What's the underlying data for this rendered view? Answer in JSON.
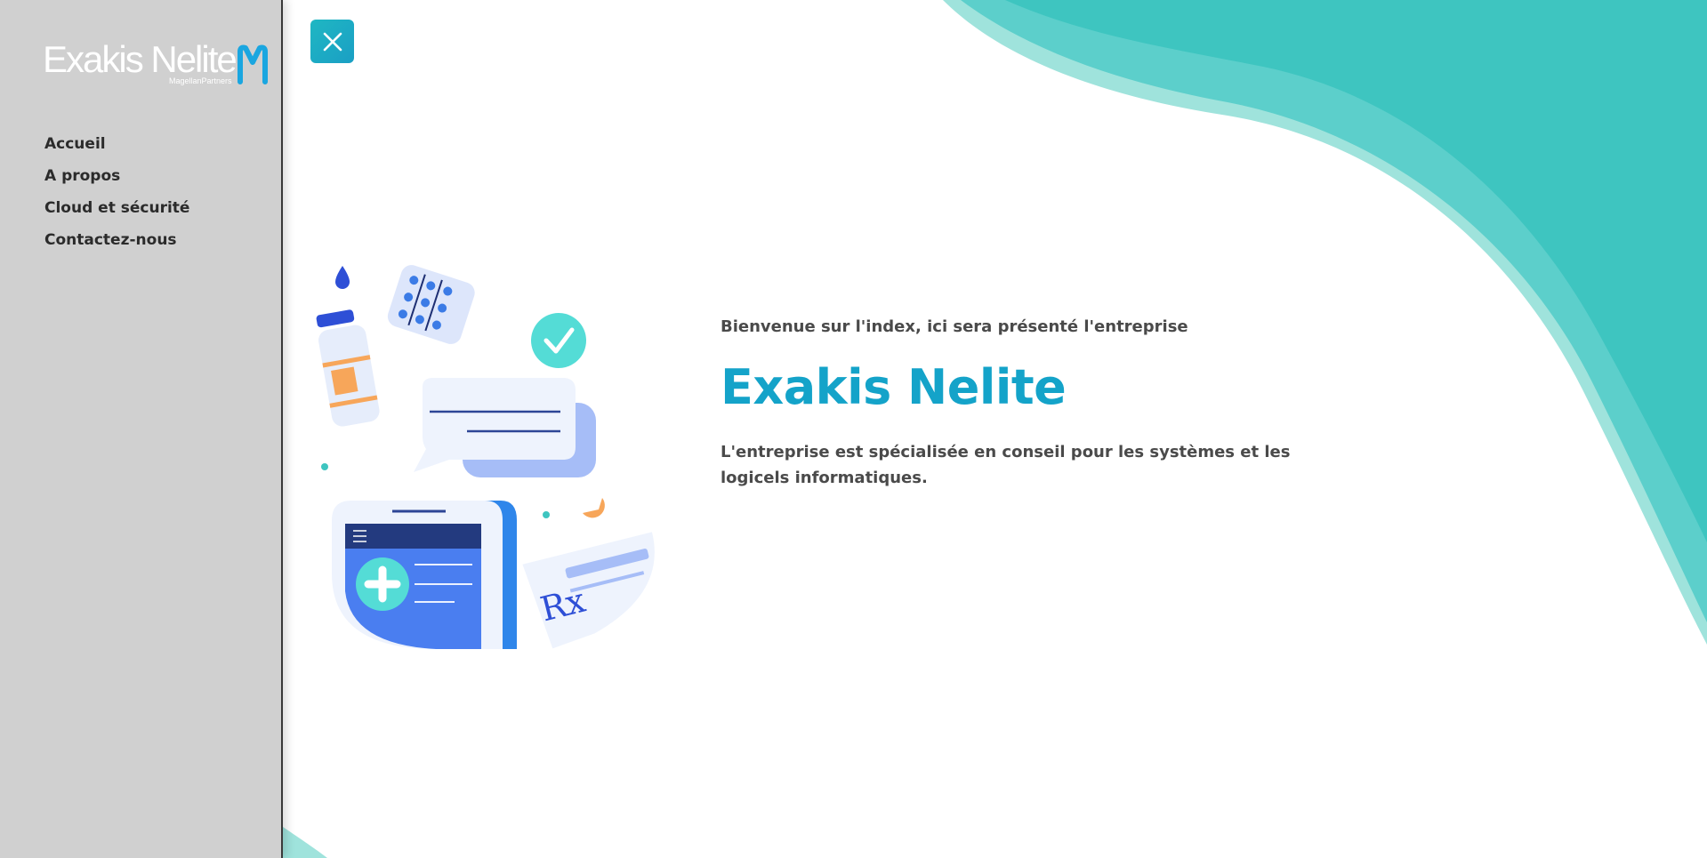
{
  "brand": {
    "logo_text": "Exakis Nelite",
    "logo_subtext": "MagellanPartners"
  },
  "nav": {
    "items": [
      {
        "label": "Accueil"
      },
      {
        "label": "A propos"
      },
      {
        "label": "Cloud et sécurité"
      },
      {
        "label": "Contactez-nous"
      }
    ]
  },
  "hero": {
    "intro": "Bienvenue sur l'index, ici sera présenté l'entreprise",
    "title": "Exakis Nelite",
    "description": "L'entreprise est spécialisée en conseil pour les systèmes et les logicels informatiques."
  },
  "icons": {
    "close": "close-icon",
    "logo_mark": "magellan-m-logo-icon"
  },
  "colors": {
    "sidebar_bg": "#d0d0d0",
    "accent": "#14a3c9",
    "wave": "#3ec5c0",
    "text": "#4a4a4a"
  }
}
